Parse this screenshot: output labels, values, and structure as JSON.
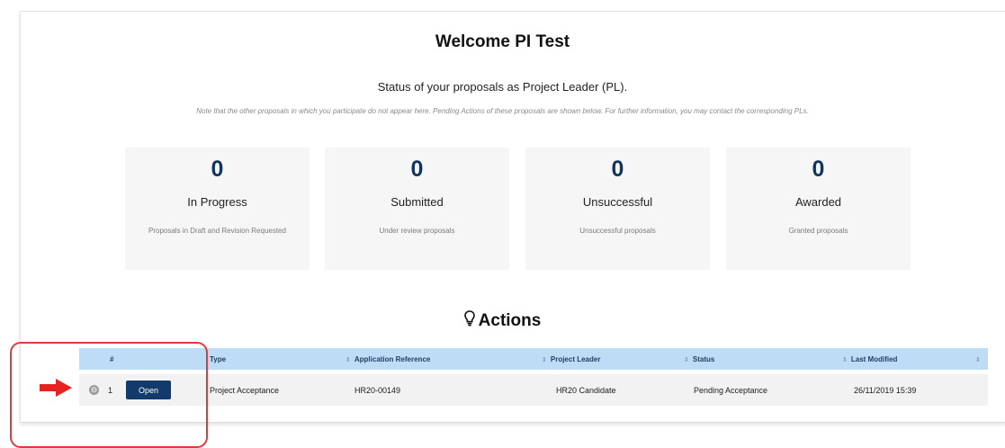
{
  "header": {
    "welcome": "Welcome PI Test",
    "subtitle": "Status of your proposals as Project Leader (PL).",
    "note": "Note that the other proposals in which you participate do not appear here. Pending Actions of these proposals are shown below. For further information, you may contact the corresponding PLs."
  },
  "stats": [
    {
      "count": "0",
      "label": "In Progress",
      "desc": "Proposals in Draft and Revision Requested"
    },
    {
      "count": "0",
      "label": "Submitted",
      "desc": "Under review proposals"
    },
    {
      "count": "0",
      "label": "Unsuccessful",
      "desc": "Unsuccessful proposals"
    },
    {
      "count": "0",
      "label": "Awarded",
      "desc": "Granted proposals"
    }
  ],
  "actions": {
    "title": "Actions",
    "icon": "lightbulb-icon",
    "columns": [
      "#",
      "Type",
      "Application Reference",
      "Project Leader",
      "Status",
      "Last Modified"
    ],
    "rows": [
      {
        "index": "1",
        "button": "Open",
        "type": "Project Acceptance",
        "reference": "HR20-00149",
        "leader": "HR20 Candidate",
        "status": "Pending Acceptance",
        "modified": "26/11/2019 15:39"
      }
    ]
  },
  "colors": {
    "accent": "#123a6b",
    "count": "#12355b",
    "table_header": "#bfdcf6",
    "annotation": "#e03a3a"
  }
}
